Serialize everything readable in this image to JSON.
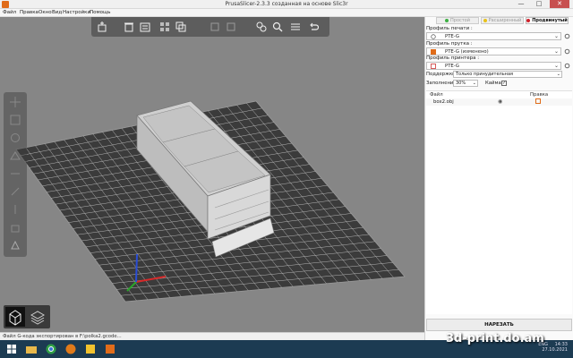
{
  "window": {
    "title": "PrusaSlicer-2.3.3 созданная на основе Slic3r",
    "minimize": "—",
    "maximize": "□",
    "close": "✕"
  },
  "menu": {
    "items": [
      "Файл",
      "Правка",
      "Окно",
      "Вид",
      "Настройки",
      "Помощь"
    ]
  },
  "modes": [
    {
      "label": "Простой",
      "color": "#3cb043",
      "active": false
    },
    {
      "label": "Расширенный",
      "color": "#e8c21a",
      "active": false
    },
    {
      "label": "Продвинутый",
      "color": "#d0202a",
      "active": true
    }
  ],
  "sidebar": {
    "print_label": "Профиль печати :",
    "print_value": "PTE-G",
    "filament_label": "Профиль прутка :",
    "filament_value": "PTE-G (изменено)",
    "printer_label": "Профиль принтера :",
    "printer_value": "PTE-G",
    "supports_label": "Поддержки:",
    "supports_value": "Только принудительная",
    "infill_label": "Заполнение:",
    "infill_value": "30%",
    "brim_label": "Кайма:",
    "brim_checked": true,
    "list_col_file": "Файл",
    "list_col_edit": "Правка",
    "objects": [
      {
        "name": "box2.obj"
      }
    ],
    "slice_button": "НАРЕЗАТЬ"
  },
  "status": {
    "text": "Файл G-кода экспортирован в F:\\polka2.gcode..."
  },
  "taskbar": {
    "lang": "ENG",
    "time": "14:33",
    "date": "27.10.2021"
  },
  "watermark": "3d-print.do.am",
  "colors": {
    "viewport_bg": "#868686",
    "bed": "#3b3b3b",
    "bed_grid": "#bdbdbd",
    "model": "#d4d4d4",
    "accent_orange": "#e06c1a",
    "taskbar": "#1c3b52"
  }
}
